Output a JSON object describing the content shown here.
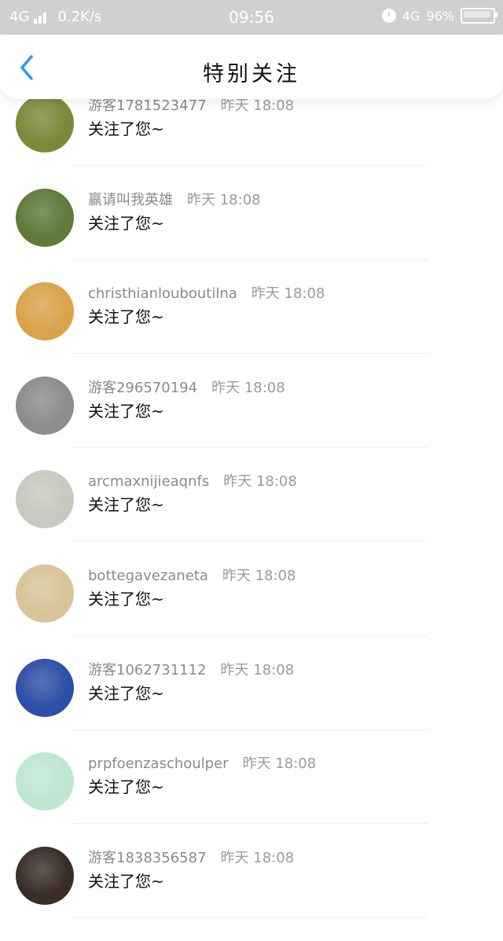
{
  "status": {
    "network": "4G",
    "speed": "0.2K/s",
    "time": "09:56",
    "network_right": "4G",
    "battery": "96%"
  },
  "header": {
    "title": "特别关注"
  },
  "items": [
    {
      "name": "游客1781523477",
      "day": "昨天",
      "time": "18:08",
      "message": "关注了您~",
      "avatar_color": "#7a8a3a"
    },
    {
      "name": "赢请叫我英雄",
      "day": "昨天",
      "time": "18:08",
      "message": "关注了您~",
      "avatar_color": "#5f7a3a"
    },
    {
      "name": "christhianlouboutilna",
      "day": "昨天",
      "time": "18:08",
      "message": "关注了您~",
      "avatar_color": "#d9a34b"
    },
    {
      "name": "游客296570194",
      "day": "昨天",
      "time": "18:08",
      "message": "关注了您~",
      "avatar_color": "#8c8c8c"
    },
    {
      "name": "arcmaxnijieaqnfs",
      "day": "昨天",
      "time": "18:08",
      "message": "关注了您~",
      "avatar_color": "#c8c8c0"
    },
    {
      "name": "bottegavezaneta",
      "day": "昨天",
      "time": "18:08",
      "message": "关注了您~",
      "avatar_color": "#d8c49a"
    },
    {
      "name": "游客1062731112",
      "day": "昨天",
      "time": "18:08",
      "message": "关注了您~",
      "avatar_color": "#2e4fa8"
    },
    {
      "name": "prpfoenzaschoulper",
      "day": "昨天",
      "time": "18:08",
      "message": "关注了您~",
      "avatar_color": "#bfe6d2"
    },
    {
      "name": "游客1838356587",
      "day": "昨天",
      "time": "18:08",
      "message": "关注了您~",
      "avatar_color": "#3a2d28"
    }
  ]
}
